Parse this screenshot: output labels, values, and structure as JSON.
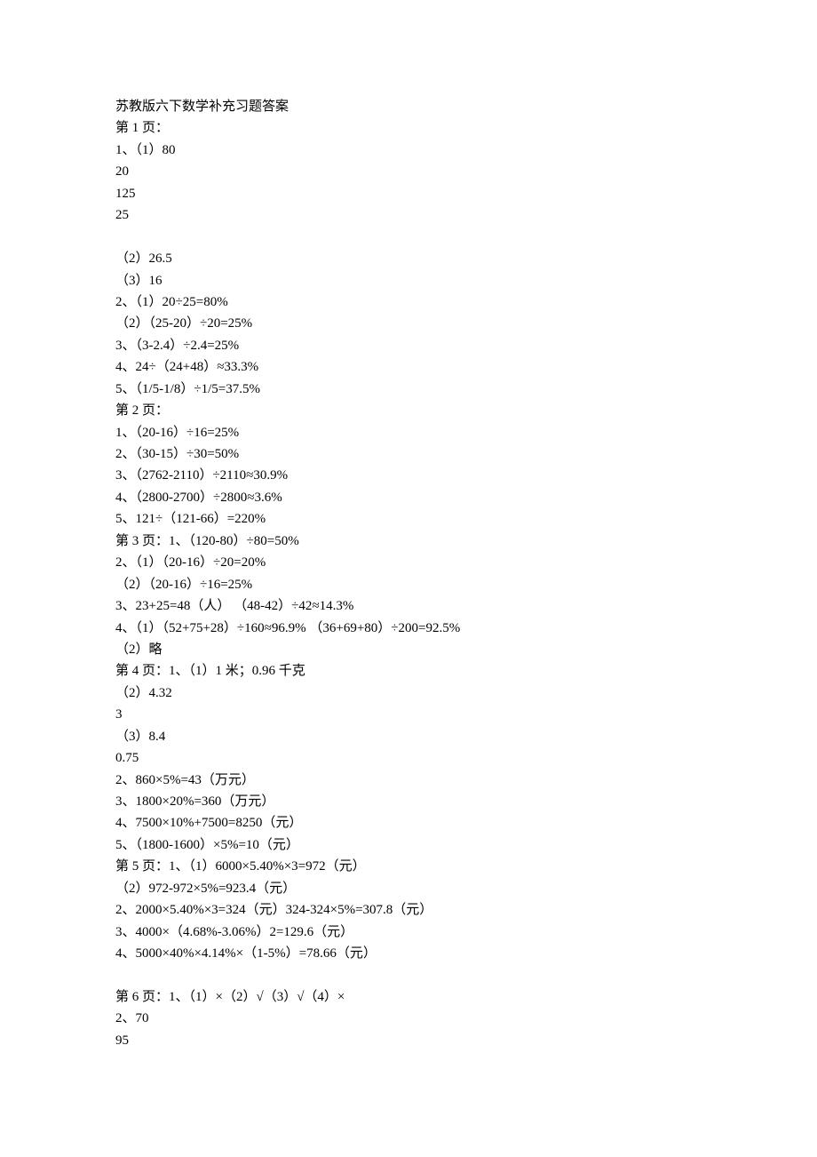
{
  "lines": [
    "苏教版六下数学补充习题答案",
    "第 1 页：",
    "1、（1）80",
    "20",
    "125",
    "25",
    "",
    "（2）26.5",
    "（3）16",
    "2、（1）20÷25=80%",
    "（2）（25-20）÷20=25%",
    "3、（3-2.4）÷2.4=25%",
    "4、24÷（24+48）≈33.3%",
    "5、（1/5-1/8）÷1/5=37.5%",
    "第 2 页：",
    "1、（20-16）÷16=25%",
    "2、（30-15）÷30=50%",
    "3、（2762-2110）÷2110≈30.9%",
    "4、（2800-2700）÷2800≈3.6%",
    "5、121÷（121-66）=220%",
    "第 3 页：1、（120-80）÷80=50%",
    "2、（1）（20-16）÷20=20%",
    "（2）（20-16）÷16=25%",
    "3、23+25=48（人） （48-42）÷42≈14.3%",
    "4、（1）（52+75+28）÷160≈96.9%    （36+69+80）÷200=92.5%",
    "（2）略",
    "第 4 页：1、（1）1 米；0.96 千克",
    "（2）4.32",
    "3",
    "（3）8.4",
    "0.75",
    "2、860×5%=43（万元）",
    "3、1800×20%=360（万元）",
    "4、7500×10%+7500=8250（元）",
    "5、（1800-1600）×5%=10（元）",
    "第 5 页：1、（1）6000×5.40%×3=972（元）",
    "（2）972-972×5%=923.4（元）",
    "2、2000×5.40%×3=324（元）324-324×5%=307.8（元）",
    "3、4000×（4.68%-3.06%）2=129.6（元）",
    "4、5000×40%×4.14%×（1-5%）=78.66（元）",
    "",
    "第 6 页：1、（1）×（2）√（3）√（4）×",
    "2、70",
    "95"
  ]
}
